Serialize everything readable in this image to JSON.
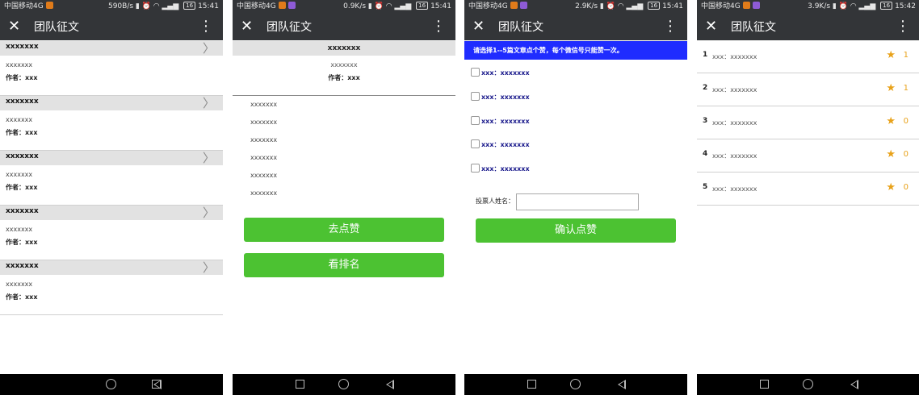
{
  "screens": [
    {
      "status": {
        "carrier": "中国移动4G",
        "speed": "590B/s",
        "battery": "16",
        "time": "15:41"
      },
      "title": "团队征文",
      "articles": [
        {
          "title": "xxxxxxx",
          "desc": "xxxxxxx",
          "author": "作者：xxx"
        },
        {
          "title": "xxxxxxx",
          "desc": "xxxxxxx",
          "author": "作者：xxx"
        },
        {
          "title": "xxxxxxx",
          "desc": "xxxxxxx",
          "author": "作者：xxx"
        },
        {
          "title": "xxxxxxx",
          "desc": "xxxxxxx",
          "author": "作者：xxx"
        },
        {
          "title": "xxxxxxx",
          "desc": "xxxxxxx",
          "author": "作者：xxx"
        }
      ]
    },
    {
      "status": {
        "carrier": "中国移动4G",
        "speed": "0.9K/s",
        "battery": "16",
        "time": "15:41"
      },
      "title": "团队征文",
      "article_title": "xxxxxxx",
      "subtitle": "xxxxxxx",
      "author": "作者：xxx",
      "paragraphs": [
        "xxxxxxx",
        "xxxxxxx",
        "xxxxxxx",
        "xxxxxxx",
        "xxxxxxx",
        "xxxxxxx"
      ],
      "like_button": "去点赞",
      "rank_button": "看排名"
    },
    {
      "status": {
        "carrier": "中国移动4G",
        "speed": "2.9K/s",
        "battery": "16",
        "time": "15:41"
      },
      "title": "团队征文",
      "banner": "请选择1--5篇文章点个赞，每个微信号只能赞一次。",
      "options": [
        "xxx：xxxxxxx",
        "xxx：xxxxxxx",
        "xxx：xxxxxxx",
        "xxx：xxxxxxx",
        "xxx：xxxxxxx"
      ],
      "voter_label": "投票人姓名：",
      "voter_value": "",
      "confirm_button": "确认点赞"
    },
    {
      "status": {
        "carrier": "中国移动4G",
        "speed": "3.9K/s",
        "battery": "16",
        "time": "15:42"
      },
      "title": "团队征文",
      "ranking": [
        {
          "rank": "1",
          "name": "xxx：xxxxxxx",
          "count": "1"
        },
        {
          "rank": "2",
          "name": "xxx：xxxxxxx",
          "count": "1"
        },
        {
          "rank": "3",
          "name": "xxx：xxxxxxx",
          "count": "0"
        },
        {
          "rank": "4",
          "name": "xxx：xxxxxxx",
          "count": "0"
        },
        {
          "rank": "5",
          "name": "xxx：xxxxxxx",
          "count": "0"
        }
      ]
    }
  ],
  "icons": {
    "close": "close-icon",
    "more": "more-vert-icon",
    "star": "star-icon",
    "chevron": "chevron-right-icon"
  },
  "colors": {
    "bar": "#333538",
    "green": "#4cc232",
    "banner": "#1f2cff",
    "star": "#e8a21a"
  }
}
